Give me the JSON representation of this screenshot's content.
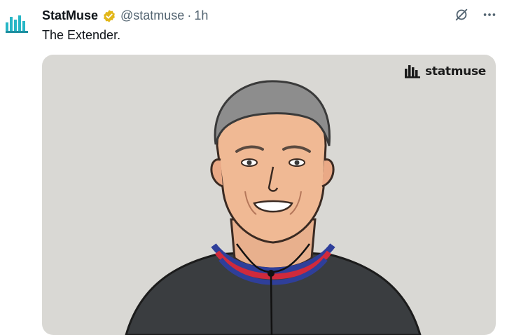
{
  "account": {
    "name": "StatMuse",
    "handle": "@statmuse",
    "separator": "·",
    "time": "1h"
  },
  "tweet": {
    "text": "The Extender."
  },
  "media": {
    "watermark": "statmuse",
    "background": "#d9d8d4"
  },
  "icons": {
    "avatar": "statmuse-logo-icon",
    "verified": "verified-badge-icon",
    "grok": "grok-icon",
    "more": "more-icon"
  },
  "colors": {
    "accent": "#1d9bf0",
    "verified": "#e2b719",
    "secondary_text": "#536471",
    "primary_text": "#0f1419",
    "logo_teal": "#27b6c6"
  }
}
